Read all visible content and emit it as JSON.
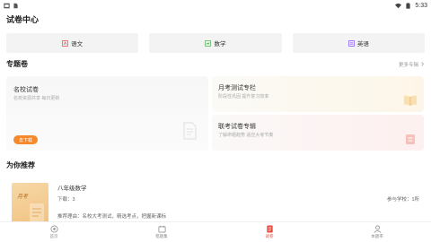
{
  "status_bar": {
    "time": "5:33",
    "left_icons": [
      "image-icon",
      "sim-icon"
    ],
    "right_icons": [
      "wifi-icon",
      "battery-icon"
    ]
  },
  "page": {
    "title": "试卷中心"
  },
  "subjects": [
    {
      "label": "语文",
      "icon": "chinese-book-icon",
      "color": "#e8483c"
    },
    {
      "label": "数学",
      "icon": "math-book-icon",
      "color": "#4caf50"
    },
    {
      "label": "英语",
      "icon": "english-book-icon",
      "color": "#7c4dff"
    }
  ],
  "special": {
    "title": "专题卷",
    "more_label": "更多专辑",
    "cards": {
      "famous": {
        "title": "名校试卷",
        "subtitle": "名校资源共享 每日更新",
        "button": "去下载"
      },
      "monthly": {
        "title": "月考测试专栏",
        "subtitle": "阶段性巩固 提升复习效率"
      },
      "joint": {
        "title": "联考试卷专辑",
        "subtitle": "了解命题趋势 适应大考节奏"
      }
    }
  },
  "recommend": {
    "title": "为你推荐",
    "item": {
      "cover_label": "月考",
      "name": "八年级数学",
      "downloads": "下载：3",
      "schools": "参与学校：1所",
      "reason": "推荐理由：名校大考测试，精选考点，把握新课标"
    }
  },
  "tabbar": {
    "tabs": [
      {
        "label": "首页",
        "icon": "home-icon",
        "active": false
      },
      {
        "label": "错题集",
        "icon": "wrongbook-icon",
        "active": false
      },
      {
        "label": "试卷",
        "icon": "paper-icon",
        "active": true
      },
      {
        "label": "本题率",
        "icon": "profile-icon",
        "active": false
      }
    ]
  },
  "colors": {
    "accent": "#e8483c",
    "button": "#f5892b"
  }
}
